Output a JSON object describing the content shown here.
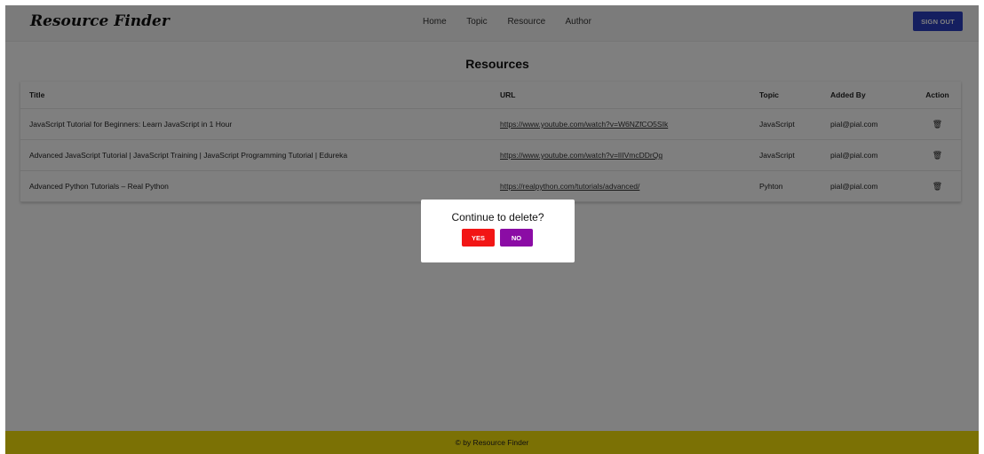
{
  "app": {
    "brand": "Resource Finder"
  },
  "nav": {
    "links": [
      "Home",
      "Topic",
      "Resource",
      "Author"
    ],
    "signout_label": "SIGN OUT"
  },
  "page": {
    "title": "Resources"
  },
  "table": {
    "headers": {
      "title": "Title",
      "url": "URL",
      "topic": "Topic",
      "added_by": "Added By",
      "action": "Action"
    },
    "rows": [
      {
        "title": "JavaScript Tutorial for Beginners: Learn JavaScript in 1 Hour",
        "url": "https://www.youtube.com/watch?v=W6NZfCO5SIk",
        "topic": "JavaScript",
        "added_by": "pial@pial.com",
        "action_icon": "trash-icon"
      },
      {
        "title": "Advanced JavaScript Tutorial | JavaScript Training | JavaScript Programming Tutorial | Edureka",
        "url": "https://www.youtube.com/watch?v=lIIVmcDDrQg",
        "topic": "JavaScript",
        "added_by": "pial@pial.com",
        "action_icon": "trash-icon"
      },
      {
        "title": "Advanced Python Tutorials – Real Python",
        "url": "https://realpython.com/tutorials/advanced/",
        "topic": "Pyhton",
        "added_by": "pial@pial.com",
        "action_icon": "trash-icon"
      }
    ]
  },
  "dialog": {
    "message": "Continue to delete?",
    "yes_label": "YES",
    "no_label": "NO"
  },
  "footer": {
    "text": "© by Resource Finder"
  },
  "colors": {
    "signout": "#2a3fc1",
    "yes": "#f21616",
    "no": "#8b0ca5",
    "footer": "#f7e20a"
  }
}
